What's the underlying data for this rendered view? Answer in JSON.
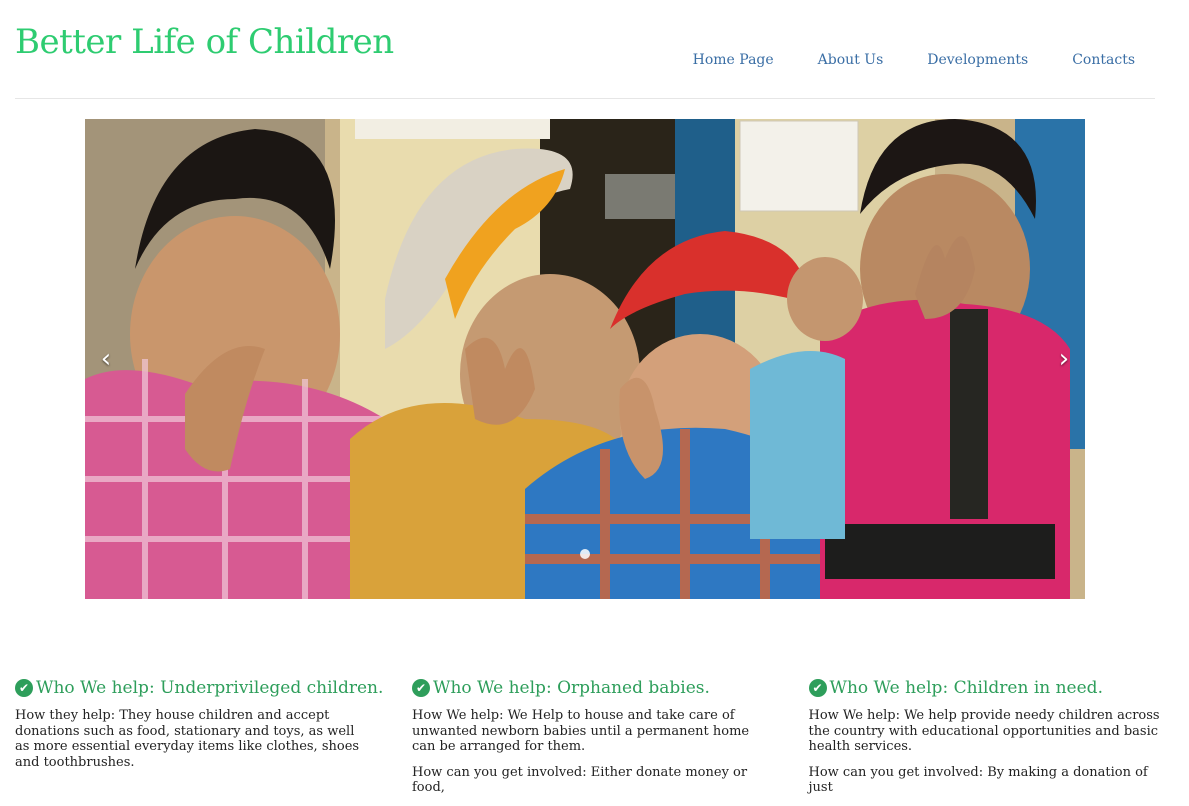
{
  "header": {
    "brand": "Better Life of Children",
    "nav": [
      "Home Page",
      "About Us",
      "Developments",
      "Contacts"
    ]
  },
  "carousel": {
    "prev_glyph": "‹",
    "next_glyph": "›",
    "indicator_count": 1,
    "image_description_icon": "children-photo"
  },
  "sections": [
    {
      "title": "Who We help: Underprivileged children.",
      "body": "How they help: They house children and accept donations such as food, stationary and toys, as well as more essential everyday items like clothes, shoes and toothbrushes.",
      "extra": ""
    },
    {
      "title": "Who We help: Orphaned babies.",
      "body": "How We help: We Help to house and take care of unwanted newborn babies until a permanent home can be arranged for them.",
      "extra": "How can you get involved: Either donate money or food,"
    },
    {
      "title": "Who We help: Children in need.",
      "body": "How We help: We help provide needy children across the country with educational opportunities and basic health services.",
      "extra": "How can you get involved: By making a donation of just"
    }
  ],
  "colors": {
    "brand": "#2ecc71",
    "nav": "#3a6ea5",
    "section_title": "#2e9e5b"
  }
}
